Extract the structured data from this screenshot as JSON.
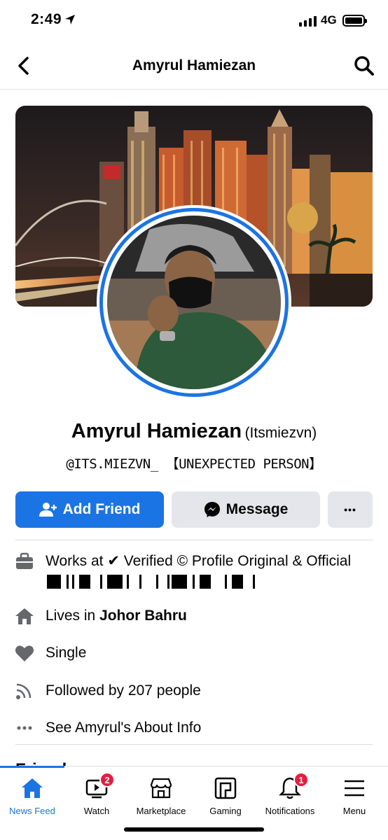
{
  "status_bar": {
    "time": "2:49",
    "network": "4G"
  },
  "header": {
    "title": "Amyrul Hamiezan"
  },
  "profile": {
    "name": "Amyrul Hamiezan",
    "alt_name": "(Itsmiezvn)",
    "bio": "@ITS.MIEZVN_ 【UNEXPECTED PERSON】"
  },
  "actions": {
    "add_friend": "Add Friend",
    "message": "Message",
    "more": "•••"
  },
  "info": {
    "work_prefix": "Works at",
    "work_text": "✔ Verified © Profile Original & Official",
    "lives_prefix": "Lives in",
    "lives_city": "Johor Bahru",
    "relationship": "Single",
    "followers": "Followed by 207 people",
    "about": "See Amyrul's About Info"
  },
  "friends_heading": "Friends",
  "tabs": [
    {
      "label": "News Feed",
      "icon": "home-icon",
      "active": true
    },
    {
      "label": "Watch",
      "icon": "watch-icon",
      "badge": "2"
    },
    {
      "label": "Marketplace",
      "icon": "marketplace-icon"
    },
    {
      "label": "Gaming",
      "icon": "gaming-icon"
    },
    {
      "label": "Notifications",
      "icon": "bell-icon",
      "badge": "1"
    },
    {
      "label": "Menu",
      "icon": "menu-icon"
    }
  ],
  "colors": {
    "accent": "#1b74e4",
    "badge": "#e41e3f",
    "secondary_button": "#e4e6eb"
  }
}
